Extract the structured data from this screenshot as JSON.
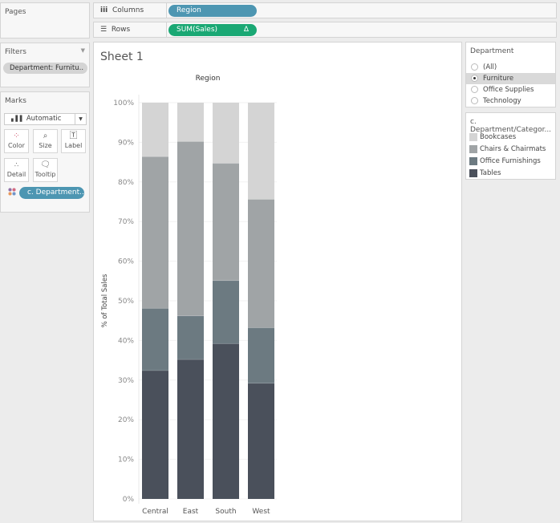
{
  "pages": {
    "title": "Pages"
  },
  "shelves": {
    "columns_label": "Columns",
    "columns_pill": "Region",
    "rows_label": "Rows",
    "rows_pill": "SUM(Sales)",
    "rows_pill_icon": "Δ"
  },
  "filters": {
    "title": "Filters",
    "pill": "Department: Furnitu.."
  },
  "marks": {
    "title": "Marks",
    "type": "Automatic",
    "buttons": [
      "Color",
      "Size",
      "Label",
      "Detail",
      "Tooltip"
    ],
    "color_pill": "c. Department.."
  },
  "sheet": {
    "title": "Sheet 1"
  },
  "department_filter": {
    "title": "Department",
    "options": [
      "(All)",
      "Furniture",
      "Office Supplies",
      "Technology"
    ],
    "selected": "Furniture"
  },
  "legend": {
    "title": "c. Department/Categor...",
    "items": [
      {
        "label": "Bookcases",
        "color": "#d4d4d4"
      },
      {
        "label": "Chairs & Chairmats",
        "color": "#a0a4a6"
      },
      {
        "label": "Office Furnishings",
        "color": "#6c7a81"
      },
      {
        "label": "Tables",
        "color": "#4a505b"
      }
    ]
  },
  "colors": {
    "columns_pill": "#4d96b2",
    "rows_pill": "#1aa874",
    "color_pill": "#4d96b2"
  },
  "chart_data": {
    "type": "bar",
    "stacked": true,
    "title": "Region",
    "xlabel": "",
    "ylabel": "% of Total Sales",
    "categories": [
      "Central",
      "East",
      "South",
      "West"
    ],
    "yticks": [
      "0%",
      "10%",
      "20%",
      "30%",
      "40%",
      "50%",
      "60%",
      "70%",
      "80%",
      "90%",
      "100%"
    ],
    "ylim": [
      0,
      100
    ],
    "series": [
      {
        "name": "Tables",
        "color": "#4a505b",
        "values": [
          32.4,
          35.2,
          39.2,
          29.2
        ]
      },
      {
        "name": "Office Furnishings",
        "color": "#6c7a81",
        "values": [
          15.7,
          11.0,
          15.9,
          14.0
        ]
      },
      {
        "name": "Chairs & Chairmats",
        "color": "#a0a4a6",
        "values": [
          38.3,
          44.0,
          29.6,
          32.4
        ]
      },
      {
        "name": "Bookcases",
        "color": "#d4d4d4",
        "values": [
          13.6,
          9.8,
          15.3,
          24.4
        ]
      }
    ]
  }
}
